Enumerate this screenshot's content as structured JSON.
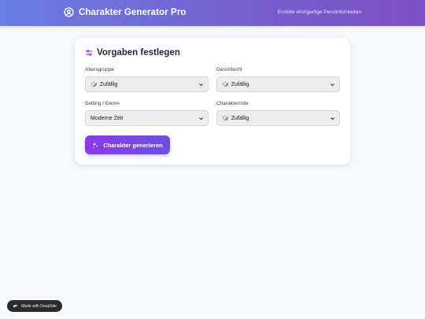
{
  "header": {
    "title": "Charakter Generator Pro",
    "tagline": "Erstelle einzigartige Persönlichkeiten",
    "icon": "user-circle-icon"
  },
  "form": {
    "title": "Vorgaben festlegen",
    "title_icon": "sliders-icon",
    "fields": [
      {
        "label": "Altersgruppe",
        "value": "Zufällig",
        "glyph": "🎲"
      },
      {
        "label": "Geschlecht",
        "value": "Zufällig",
        "glyph": "🎲"
      },
      {
        "label": "Setting / Genre",
        "value": "Moderne Zeit",
        "glyph": ""
      },
      {
        "label": "Charakterrolle",
        "value": "Zufällig",
        "glyph": "🎲"
      }
    ],
    "generate_label": "Charakter generieren"
  },
  "badge": {
    "label": "Made with DeepSite"
  },
  "colors": {
    "header_start": "#6a7ee3",
    "header_end": "#7d4fc3",
    "button_start": "#8b3ae8",
    "button_end": "#6b4fe0",
    "accent": "#9b3fd1"
  }
}
